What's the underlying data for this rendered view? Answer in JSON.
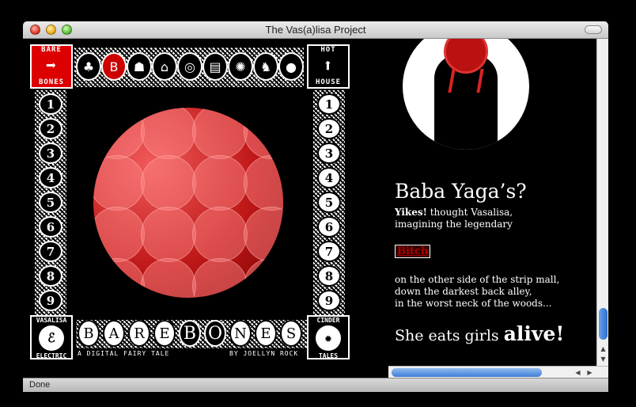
{
  "window": {
    "title": "The Vas(a)lisa Project"
  },
  "status": {
    "text": "Done"
  },
  "nav": {
    "bare_bones_label_top": "BARE",
    "bare_bones_label_bottom": "BONES",
    "hot_house_label_top": "HOT",
    "hot_house_label_bottom": "HOUSE",
    "top_icons": [
      "tree",
      "b-block",
      "figure",
      "house",
      "ring",
      "book",
      "wheel",
      "bird",
      "circle"
    ],
    "left_numbers": [
      "1",
      "2",
      "3",
      "4",
      "5",
      "6",
      "7",
      "8",
      "9"
    ],
    "right_numbers": [
      "1",
      "2",
      "3",
      "4",
      "5",
      "6",
      "7",
      "8",
      "9"
    ]
  },
  "branding": {
    "left_top": "VASALISA",
    "left_bottom": "ELECTRIC",
    "right_top": "CINDER",
    "right_bottom": "TALES",
    "title_letters": [
      "B",
      "A",
      "R",
      "E",
      "B",
      "O",
      "N",
      "E",
      "S"
    ],
    "subtitle_left": "A DIGITAL FAIRY TALE",
    "subtitle_right": "BY JOELLYN ROCK"
  },
  "story": {
    "heading": "Baba Yaga’s?",
    "lead_bold": "Yikes!",
    "lead_line1": " thought Vasalisa,",
    "lead_line2": "imagining the legendary",
    "link": "Bitch",
    "para_line1": "on the other side of the strip mall,",
    "para_line2": "down the darkest back alley,",
    "para_line3": "in the worst neck of the woods...",
    "closer_text": "She eats girls ",
    "closer_bold": "alive!"
  },
  "colors": {
    "accent_red": "#cc0000",
    "link_red": "#aa0000",
    "scroll_blue": "#2d6fd0"
  }
}
